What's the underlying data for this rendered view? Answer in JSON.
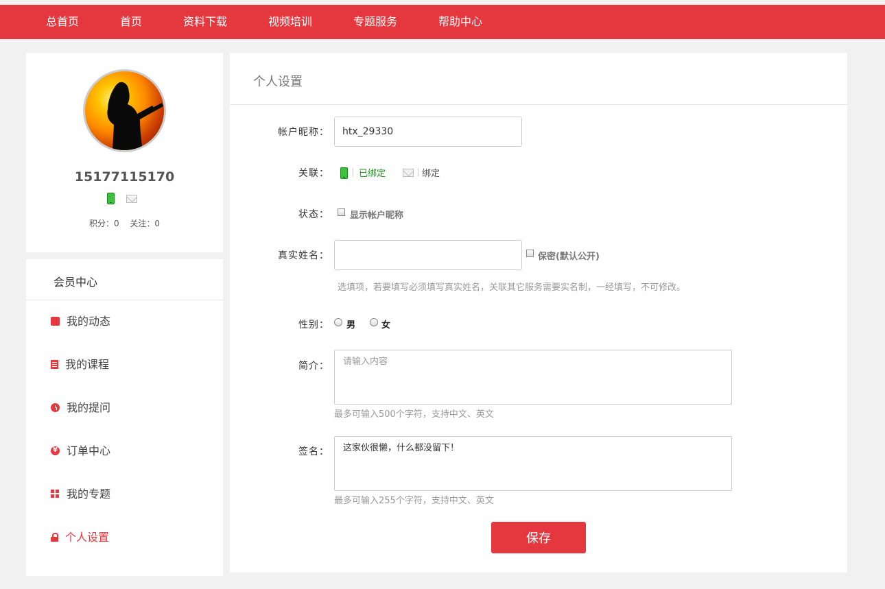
{
  "nav": {
    "items": [
      "总首页",
      "首页",
      "资料下载",
      "视频培训",
      "专题服务",
      "帮助中心"
    ]
  },
  "profile": {
    "username": "15177115170",
    "points_label": "积分：0",
    "follows_label": "关注：0",
    "icons": [
      "phone-icon",
      "mail-icon"
    ]
  },
  "member_menu": {
    "title": "会员中心",
    "items": [
      {
        "label": "我的动态",
        "icon": "chat-icon"
      },
      {
        "label": "我的课程",
        "icon": "book-icon"
      },
      {
        "label": "我的提问",
        "icon": "clock-icon"
      },
      {
        "label": "订单中心",
        "icon": "yen-icon"
      },
      {
        "label": "我的专题",
        "icon": "grid-icon"
      },
      {
        "label": "个人设置",
        "icon": "lock-icon"
      }
    ],
    "active_index": 5
  },
  "settings": {
    "title": "个人设置",
    "nickname": {
      "label": "帐户昵称：",
      "value": "htx_29330"
    },
    "link": {
      "label": "关联：",
      "phone_status": "已绑定",
      "email_status": "绑定"
    },
    "status": {
      "label": "状态：",
      "checkbox_label": "显示帐户昵称",
      "checked": false
    },
    "realname": {
      "label": "真实姓名：",
      "value": "",
      "private_label": "保密(默认公开)",
      "private_checked": false,
      "hint": "选填项，若要填写必须填写真实姓名，关联其它服务需要实名制，一经填写，不可修改。"
    },
    "gender": {
      "label": "性别：",
      "options": [
        "男",
        "女"
      ],
      "selected": null
    },
    "intro": {
      "label": "简介：",
      "placeholder": "请输入内容",
      "value": "",
      "hint": "最多可输入500个字符，支持中文、英文"
    },
    "signature": {
      "label": "签名：",
      "value": "这家伙很懒，什么都没留下！",
      "hint": "最多可输入255个字符，支持中文、英文"
    },
    "save_label": "保存"
  },
  "colors": {
    "accent": "#e5373e",
    "bound_green": "#1a9a1a",
    "background": "#f1f1f1"
  }
}
